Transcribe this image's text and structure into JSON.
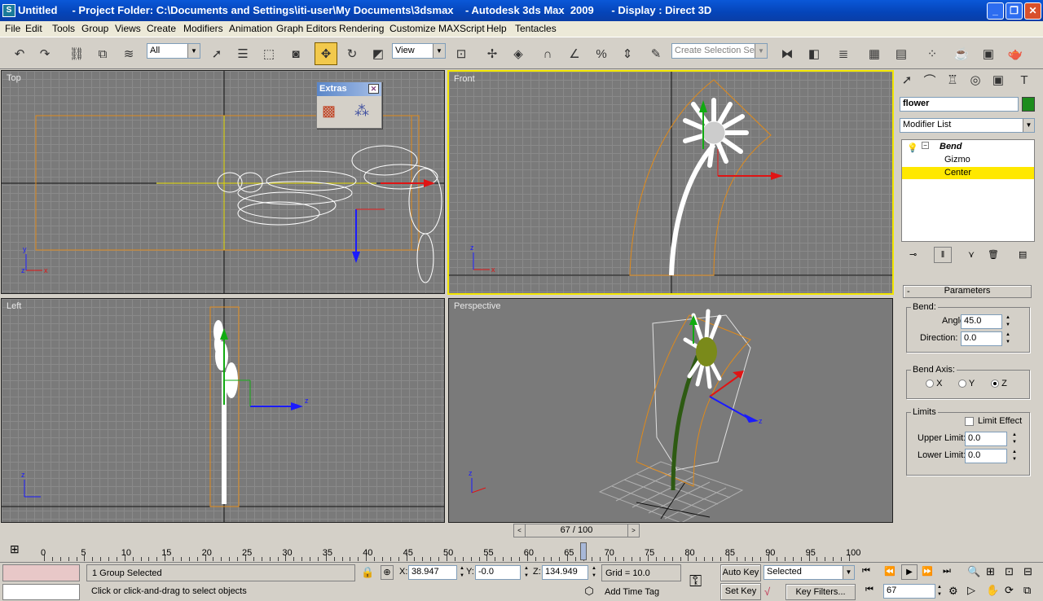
{
  "window": {
    "app_icon": "3dsmax-icon",
    "title_untitled": "Untitled",
    "title_folder": "- Project Folder: C:\\Documents and Settings\\iti-user\\My Documents\\3dsmax",
    "title_app": "- Autodesk 3ds Max  2009",
    "title_display": "- Display : Direct 3D",
    "controls": [
      "_",
      "❐",
      "✕"
    ]
  },
  "menu": [
    "File",
    "Edit",
    "Tools",
    "Group",
    "Views",
    "Create",
    "Modifiers",
    "Animation",
    "Graph Editors",
    "Rendering",
    "Customize",
    "MAXScript",
    "Help",
    "Tentacles"
  ],
  "toolbar": {
    "selection_filter": "All",
    "reference_coord": "View",
    "named_selection": "Create Selection Set"
  },
  "viewports": {
    "top": "Top",
    "front": "Front",
    "left": "Left",
    "perspective": "Perspective"
  },
  "extras_panel": {
    "title": "Extras"
  },
  "command_panel": {
    "object_name": "flower",
    "object_color": "#1c8c1c",
    "modifier_list": "Modifier List",
    "stack": {
      "modifier": "Bend",
      "gizmo": "Gizmo",
      "center": "Center"
    },
    "rollout_title": "Parameters",
    "bend_group": "Bend:",
    "angle_label": "Angle:",
    "angle_value": "45.0",
    "direction_label": "Direction:",
    "direction_value": "0.0",
    "axis_group": "Bend Axis:",
    "axis_x": "X",
    "axis_y": "Y",
    "axis_z": "Z",
    "selected_axis": "Z",
    "limits_group": "Limits",
    "limit_effect": "Limit Effect",
    "upper_label": "Upper Limit:",
    "upper_value": "0.0",
    "lower_label": "Lower Limit:",
    "lower_value": "0.0"
  },
  "timeline": {
    "frame_label": "67 / 100",
    "current_frame": 67,
    "total_frames": 100,
    "ticks": [
      "0",
      "5",
      "10",
      "15",
      "20",
      "25",
      "30",
      "35",
      "40",
      "45",
      "50",
      "55",
      "60",
      "65",
      "70",
      "75",
      "80",
      "85",
      "90",
      "95",
      "100"
    ]
  },
  "status": {
    "selection": "1 Group Selected",
    "prompt": "Click or click-and-drag to select objects",
    "x_label": "X:",
    "x_value": "38.947",
    "y_label": "Y:",
    "y_value": "-0.0",
    "z_label": "Z:",
    "z_value": "134.949",
    "grid": "Grid = 10.0",
    "add_time_tag": "Add Time Tag",
    "auto_key": "Auto Key",
    "set_key": "Set Key",
    "key_mode": "Selected",
    "key_filters": "Key Filters...",
    "frame_field": "67"
  }
}
